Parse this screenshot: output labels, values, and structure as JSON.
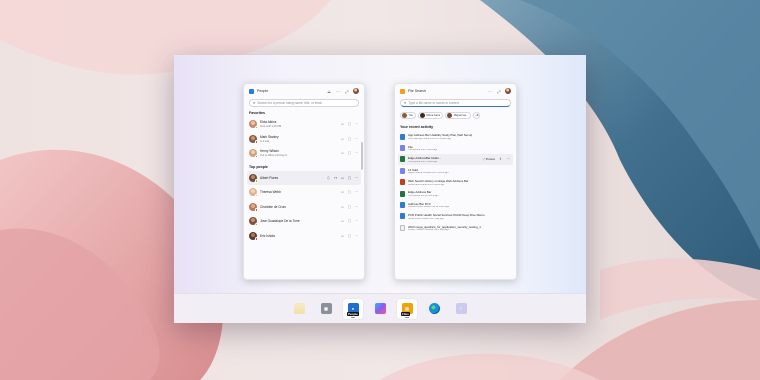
{
  "people_flyout": {
    "title": "People",
    "search_placeholder": "Search for a person using name, title, or email",
    "favorites_label": "Favorites",
    "favorites": [
      {
        "name": "Elvia Atkins",
        "status": "Free until 1:00 PM",
        "avatar_color": "#c98b6a",
        "status_color": "#6bb700"
      },
      {
        "name": "Mark Stanley",
        "status": "In a call",
        "avatar_color": "#8a5a3c",
        "status_color": "#d13438"
      },
      {
        "name": "Henry Wilson",
        "status": "Out of office until Aug 9",
        "avatar_color": "#d4a07a",
        "status_color": "#c239b3"
      }
    ],
    "top_people_label": "Top people",
    "top_people": [
      {
        "name": "Albert Flores",
        "avatar_color": "#6e4a36",
        "status_color": "#6bb700"
      },
      {
        "name": "Theresa Webb",
        "avatar_color": "#e0b48a",
        "status_color": "#f8c000"
      },
      {
        "name": "Charlotte de Crum",
        "avatar_color": "#b77a58",
        "status_color": "#d13438"
      },
      {
        "name": "Jose Guadalupe De la Torre",
        "avatar_color": "#7a5440",
        "status_color": "#6bb700"
      },
      {
        "name": "Eric Ishida",
        "avatar_color": "#5a3c2c",
        "status_color": "#d13438"
      }
    ]
  },
  "files_flyout": {
    "title": "File Search",
    "search_placeholder": "Type a file name or words in content",
    "people_chips": [
      {
        "name": "You",
        "color": "#8a5a3c"
      },
      {
        "name": "Mona Kane",
        "color": "#3c2a20"
      },
      {
        "name": "Miguel Ga...",
        "color": "#6e4a36"
      }
    ],
    "chips_more": "+8",
    "recent_label": "Your recent activity",
    "preview_label": "Preview",
    "files": [
      {
        "name": "App Address Bar Usability Study Plan (Self Serve)",
        "sub": "Colin Ballinger shared this 20 minutes ago",
        "color": "#2b7cd3"
      },
      {
        "name": "File",
        "sub": "You opened this 2 hours ago",
        "color": "#7b83eb"
      },
      {
        "name": "Edge AddressBar Hiddo...",
        "sub": "You opened this 2 hours ago",
        "color": "#217346"
      },
      {
        "name": "12 Sdef",
        "sub": "Miguel Garcia modified this 3 hours ago",
        "color": "#7b83eb"
      },
      {
        "name": "Web Search History on Edge Web Address Bar",
        "sub": "Mona Kane shared this 8 hours ago",
        "color": "#c43e1c"
      },
      {
        "name": "Edge Address Bar",
        "sub": "You opened this 12 hours ago",
        "color": "#217346"
      },
      {
        "name": "Address Bar PCC",
        "sub": "Celeste Burton shared this 12 hours ago",
        "color": "#2b7cd3"
      },
      {
        "name": "PCR Public Health Social Services PHCR Deep Dive Memo",
        "sub": "Nicole Partin shared this 1 day ago",
        "color": "#2b7cd3"
      },
      {
        "name": "2023 mega_quadrant_for_application_security_testing_1",
        "sub": "Bruken Hansen modified this 2 days ago",
        "color": "#e8e8e8"
      }
    ]
  },
  "taskbar": {
    "badge_people": "People",
    "badge_files": "Files",
    "items": [
      "file-explorer",
      "calculator",
      "people",
      "copilot",
      "file-search",
      "edge",
      "teams"
    ]
  }
}
